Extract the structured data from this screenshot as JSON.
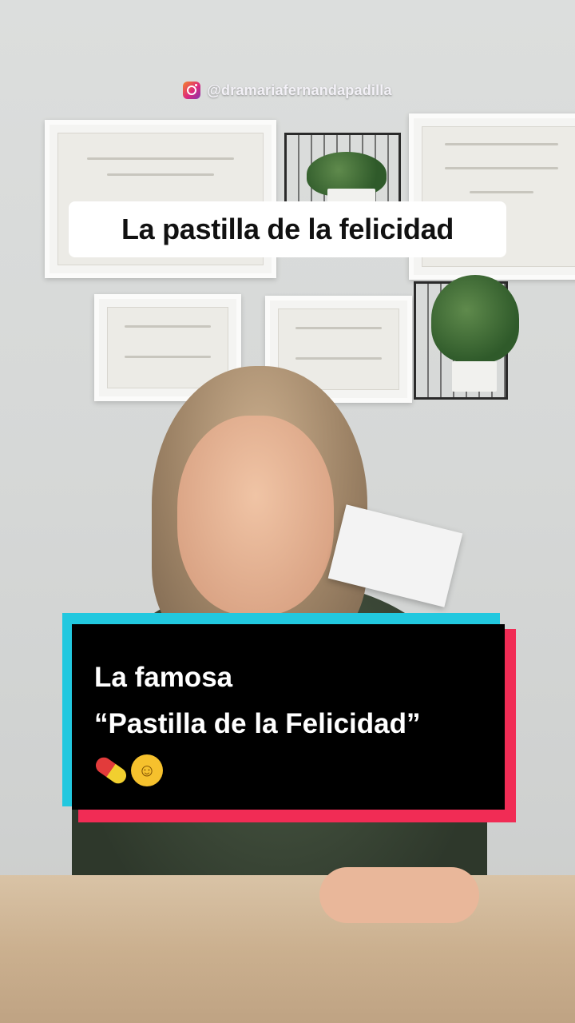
{
  "watermark": {
    "icon": "instagram-icon",
    "handle": "@dramariafernandapadilla"
  },
  "title": "La pastilla de la felicidad",
  "caption": {
    "line1": "La famosa",
    "line2": "“Pastilla de la Felicidad”",
    "emojis": [
      "pill-icon",
      "smiling-face-icon"
    ],
    "colors": {
      "cyan": "#22c8df",
      "red": "#f12c55",
      "box": "#000000"
    }
  }
}
